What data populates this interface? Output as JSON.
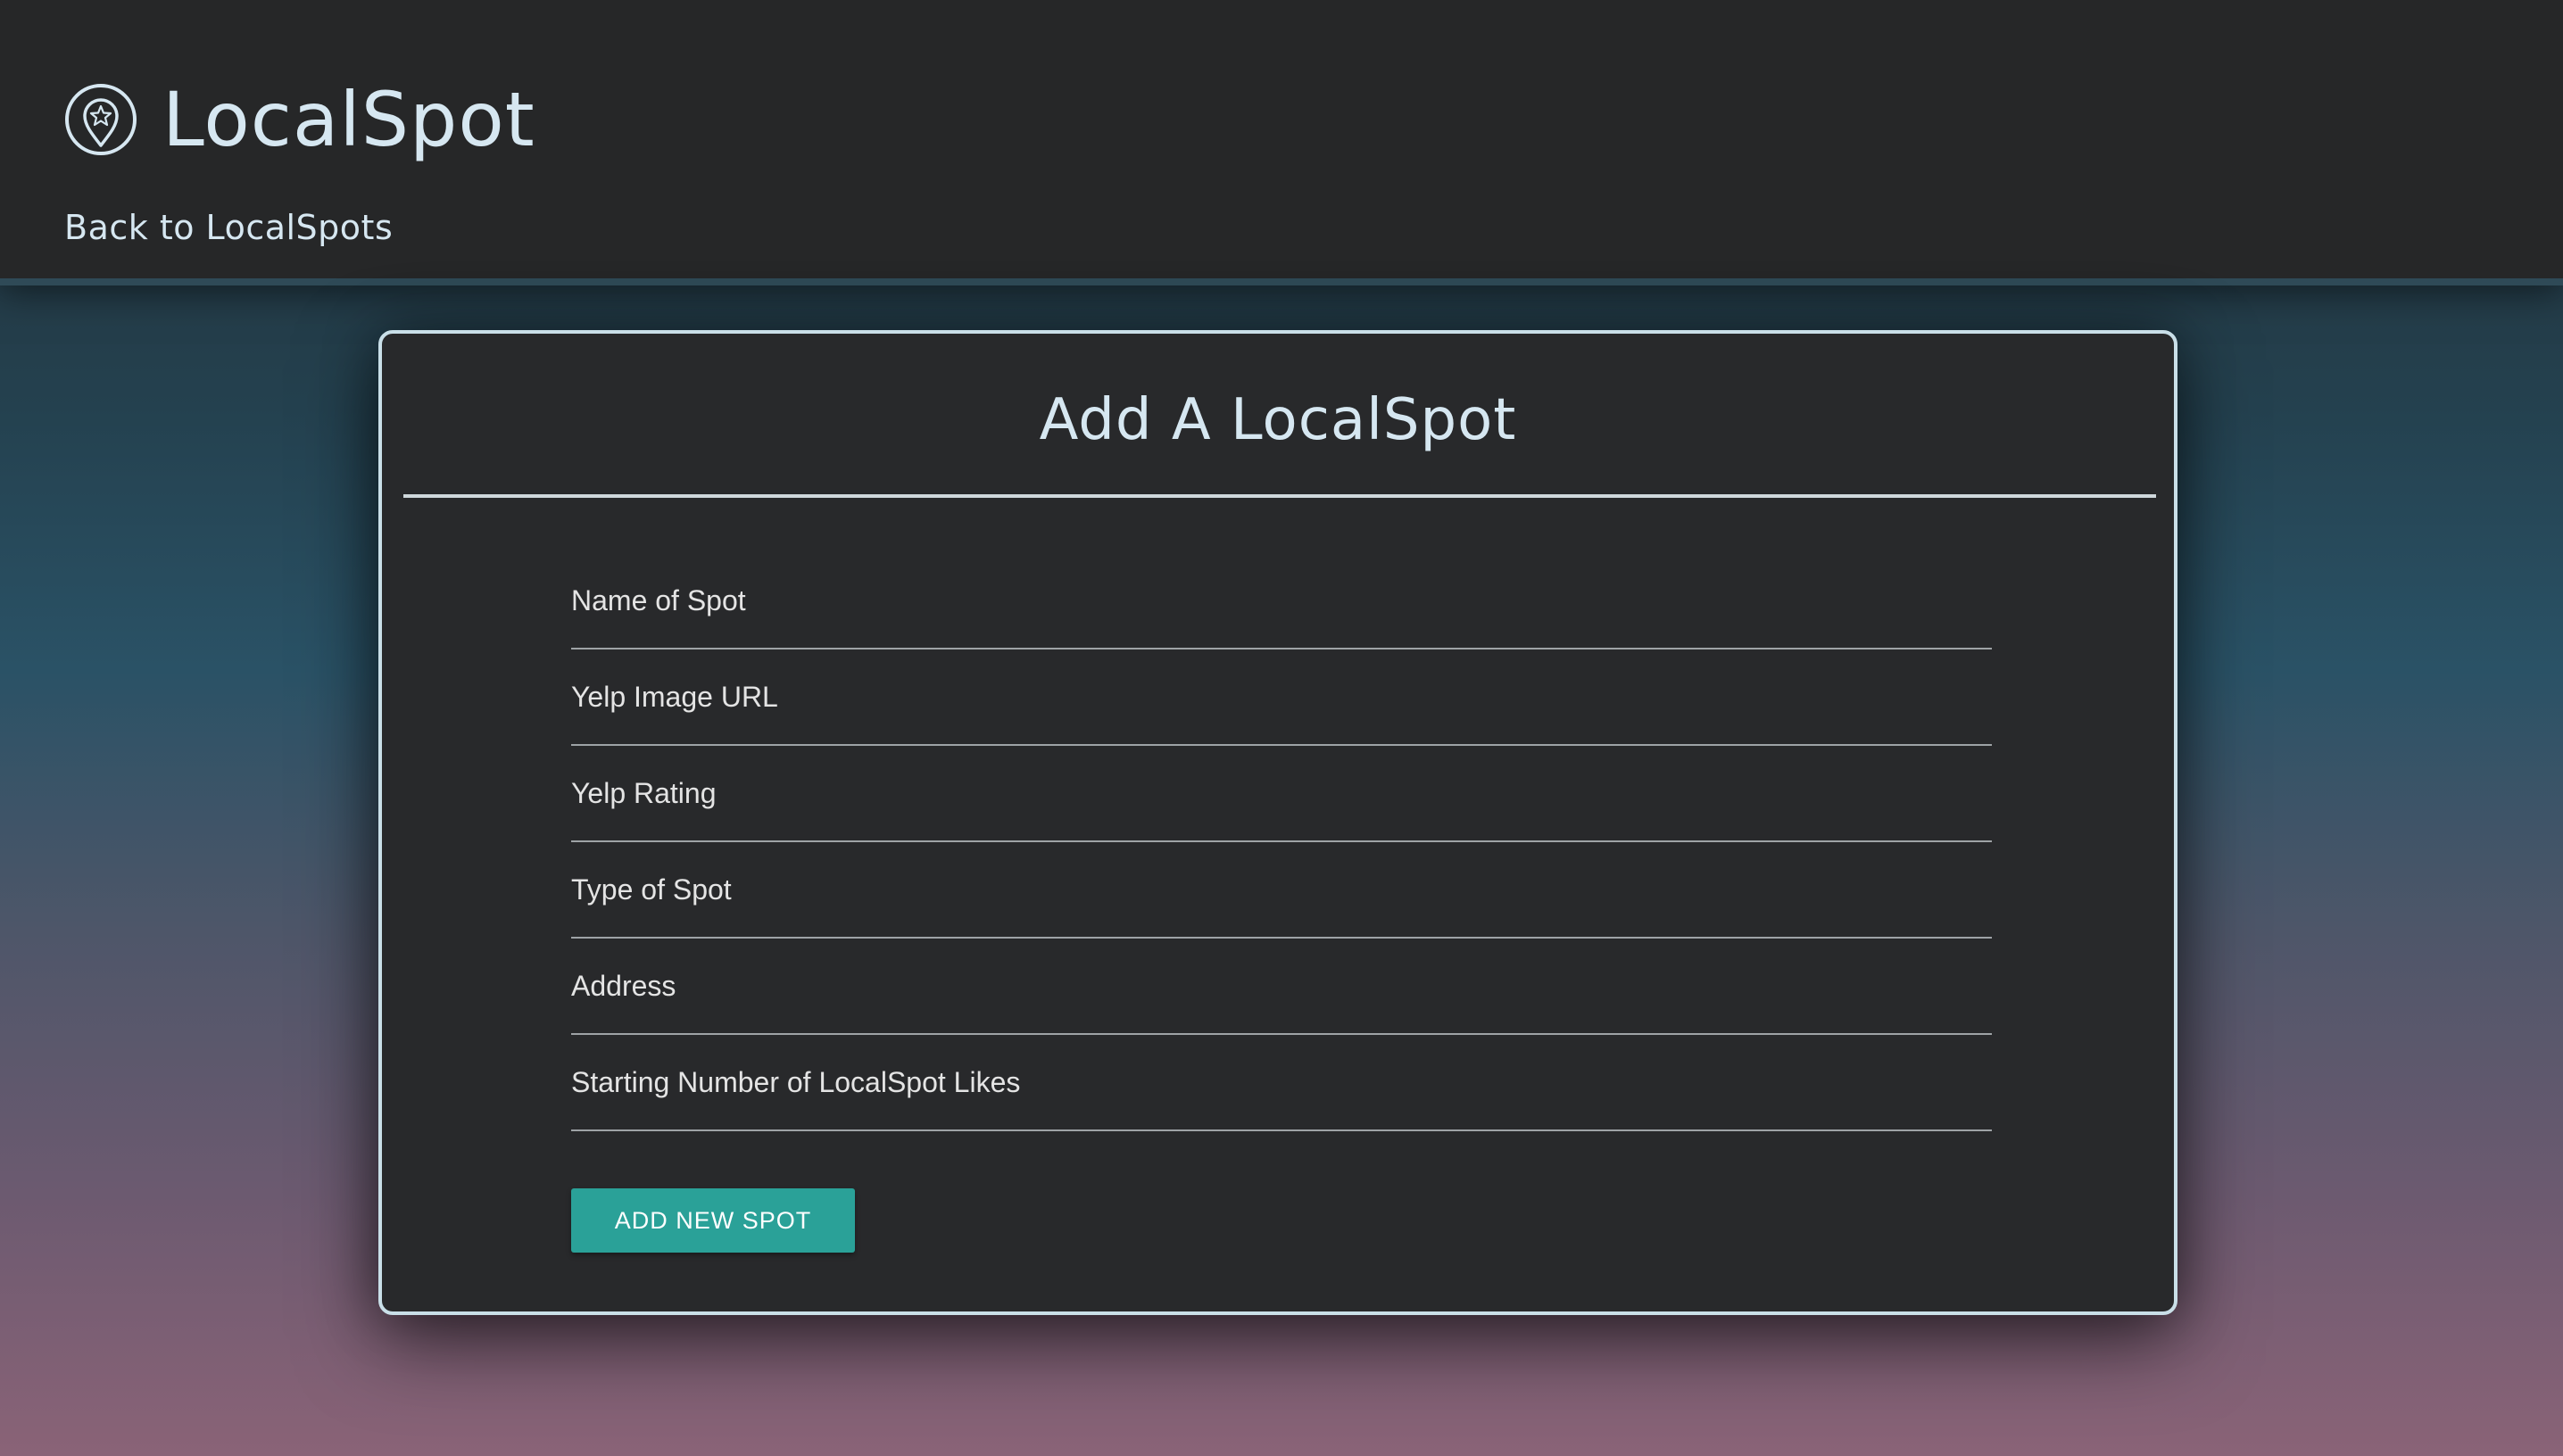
{
  "header": {
    "brand_title": "LocalSpot",
    "brand_icon": "location-star-pin-icon",
    "back_link_label": "Back to LocalSpots"
  },
  "form": {
    "title": "Add A LocalSpot",
    "fields": [
      {
        "placeholder": "Name of Spot",
        "value": ""
      },
      {
        "placeholder": "Yelp Image URL",
        "value": ""
      },
      {
        "placeholder": "Yelp Rating",
        "value": ""
      },
      {
        "placeholder": "Type of Spot",
        "value": ""
      },
      {
        "placeholder": "Address",
        "value": ""
      },
      {
        "placeholder": "Starting Number of LocalSpot Likes",
        "value": ""
      }
    ],
    "submit_label": "ADD NEW SPOT"
  },
  "colors": {
    "header_bg": "#262728",
    "card_bg": "#28292b",
    "accent": "#2aa198",
    "text_light": "#d6e7f1"
  }
}
